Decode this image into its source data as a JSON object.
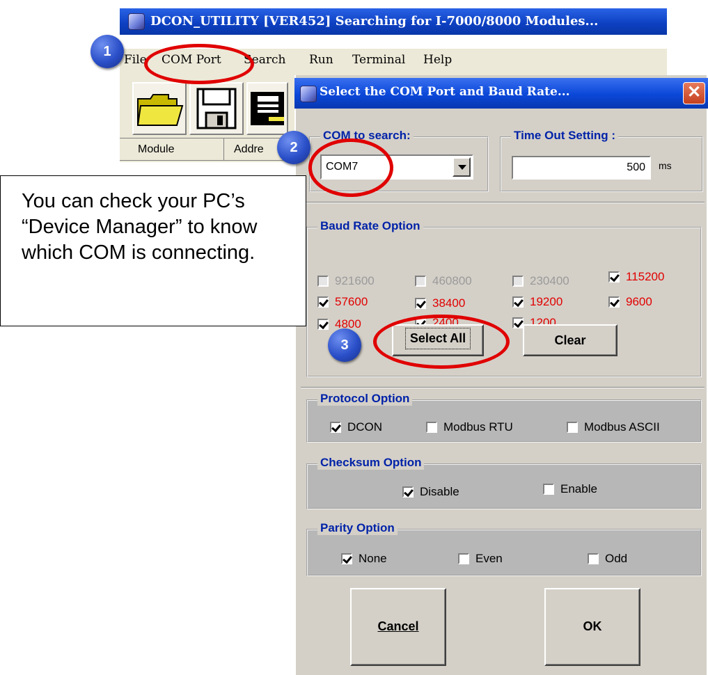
{
  "main_window": {
    "title": "DCON_UTILITY [VER452] Searching for I-7000/8000 Modules...",
    "menu": [
      "File",
      "COM Port",
      "Search",
      "Run",
      "Terminal",
      "Help"
    ],
    "grid_columns": [
      "Module",
      "Addre"
    ]
  },
  "dialog": {
    "title": "Select the COM Port and Baud Rate...",
    "com_group_label": "COM to search:",
    "com_value": "COM7",
    "timeout_group_label": "Time Out Setting :",
    "timeout_value": "500",
    "timeout_unit": "ms",
    "baud_group_label": "Baud Rate Option",
    "baud_rates": [
      {
        "label": "921600",
        "checked": false,
        "enabled": false
      },
      {
        "label": "460800",
        "checked": false,
        "enabled": false
      },
      {
        "label": "230400",
        "checked": false,
        "enabled": false
      },
      {
        "label": "115200",
        "checked": true,
        "enabled": true
      },
      {
        "label": "57600",
        "checked": true,
        "enabled": true
      },
      {
        "label": "38400",
        "checked": true,
        "enabled": true
      },
      {
        "label": "19200",
        "checked": true,
        "enabled": true
      },
      {
        "label": "9600",
        "checked": true,
        "enabled": true
      },
      {
        "label": "4800",
        "checked": true,
        "enabled": true
      },
      {
        "label": "2400",
        "checked": true,
        "enabled": true
      },
      {
        "label": "1200",
        "checked": true,
        "enabled": true
      }
    ],
    "select_all_label": "Select  All",
    "clear_label": "Clear",
    "protocol_group_label": "Protocol Option",
    "protocols": [
      {
        "label": "DCON",
        "checked": true
      },
      {
        "label": "Modbus RTU",
        "checked": false
      },
      {
        "label": "Modbus ASCII",
        "checked": false
      }
    ],
    "checksum_group_label": "Checksum  Option",
    "checksum": [
      {
        "label": "Disable",
        "checked": true
      },
      {
        "label": "Enable",
        "checked": false
      }
    ],
    "parity_group_label": "Parity Option",
    "parity": [
      {
        "label": "None",
        "checked": true
      },
      {
        "label": "Even",
        "checked": false
      },
      {
        "label": "Odd",
        "checked": false
      }
    ],
    "cancel_label": "Cancel",
    "ok_label": "OK"
  },
  "annotations": {
    "step_1": "1",
    "step_2": "2",
    "step_3": "3",
    "callout_text": "You can check your PC’s “Device Manager” to know which COM is connecting.",
    "highlight_color": "#e00000"
  }
}
